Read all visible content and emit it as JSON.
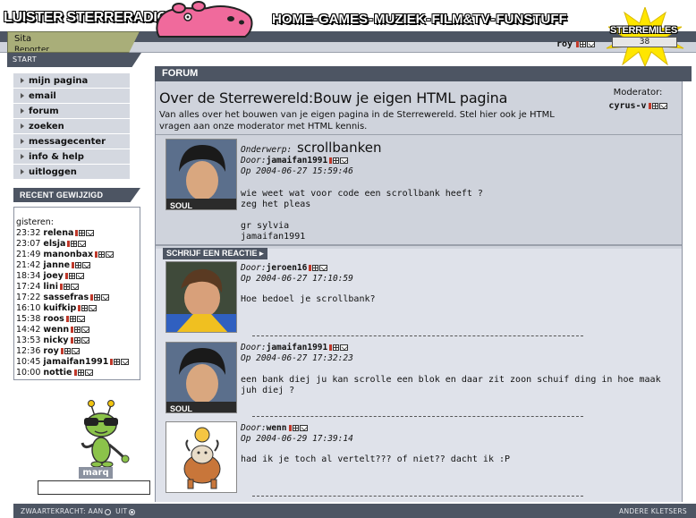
{
  "header": {
    "logo": "LUISTER STERRERADIO",
    "nav": [
      "HOME",
      "GAMES",
      "MUZIEK",
      "FILM&TV",
      "FUNSTUFF"
    ],
    "nav_separator": "-",
    "user": "roy",
    "sidehead_line1": "Sita",
    "sidehead_line2": "Reporter",
    "start_label": "START",
    "miles_label": "STERREMILES",
    "miles_value": "38"
  },
  "sidebar": {
    "menu": [
      {
        "label": "mijn pagina"
      },
      {
        "label": "email"
      },
      {
        "label": "forum"
      },
      {
        "label": "zoeken"
      },
      {
        "label": "messagecenter"
      },
      {
        "label": "info & help"
      },
      {
        "label": "uitloggen"
      }
    ],
    "recent_title": "RECENT GEWIJZIGD",
    "recent_day": "gisteren:",
    "recent": [
      {
        "time": "23:32",
        "name": "relena"
      },
      {
        "time": "23:07",
        "name": "elsja"
      },
      {
        "time": "21:49",
        "name": "manonbax"
      },
      {
        "time": "21:42",
        "name": "janne"
      },
      {
        "time": "18:34",
        "name": "joey"
      },
      {
        "time": "17:24",
        "name": "lini"
      },
      {
        "time": "17:22",
        "name": "sassefras"
      },
      {
        "time": "16:10",
        "name": "kuifkip"
      },
      {
        "time": "15:38",
        "name": "roos"
      },
      {
        "time": "14:42",
        "name": "wenn"
      },
      {
        "time": "13:53",
        "name": "nicky"
      },
      {
        "time": "12:36",
        "name": "roy"
      },
      {
        "time": "10:45",
        "name": "jamaifan1991"
      },
      {
        "time": "10:00",
        "name": "nottie"
      }
    ],
    "mascot_name": "marq"
  },
  "forum": {
    "tab_label": "FORUM",
    "title": "Over de Sterrewereld:Bouw je eigen HTML pagina",
    "description": "Van alles over het bouwen van je eigen pagina in de Sterrewereld. Stel hier ook je HTML vragen aan onze moderator met HTML kennis.",
    "moderator_label": "Moderator:",
    "moderator_name": "cyrus-v",
    "subject_label": "Onderwerp:",
    "subject": "scrollbanken",
    "reply_label": "SCHRIJF EEN REACTIE",
    "posts": [
      {
        "door_label": "Door:",
        "author": "jamaifan1991",
        "date": "Op 2004-06-27 15:59:46",
        "body": "wie weet wat voor code een scrollbank heeft ?\nzeg het pleas\n\ngr sylvia\njamaifan1991",
        "avatar_caption": "SOUL"
      },
      {
        "door_label": "Door:",
        "author": "jeroen16",
        "date": "Op 2004-06-27 17:10:59",
        "body": "Hoe bedoel je scrollbank?"
      },
      {
        "door_label": "Door:",
        "author": "jamaifan1991",
        "date": "Op 2004-06-27 17:32:23",
        "body": "een bank diej ju kan scrolle een blok en daar zit zoon schuif ding in hoe maak juh diej ?",
        "avatar_caption": "SOUL"
      },
      {
        "door_label": "Door:",
        "author": "wenn",
        "date": "Op 2004-06-29 17:39:14",
        "body": "had ik je toch al vertelt??? of niet?? dacht ik :P"
      }
    ]
  },
  "footer": {
    "left_label": "ZWAARTEKRACHT:",
    "opt_on": "AAN",
    "opt_off": "UIT",
    "right_label": "ANDERE KLETSERS"
  }
}
